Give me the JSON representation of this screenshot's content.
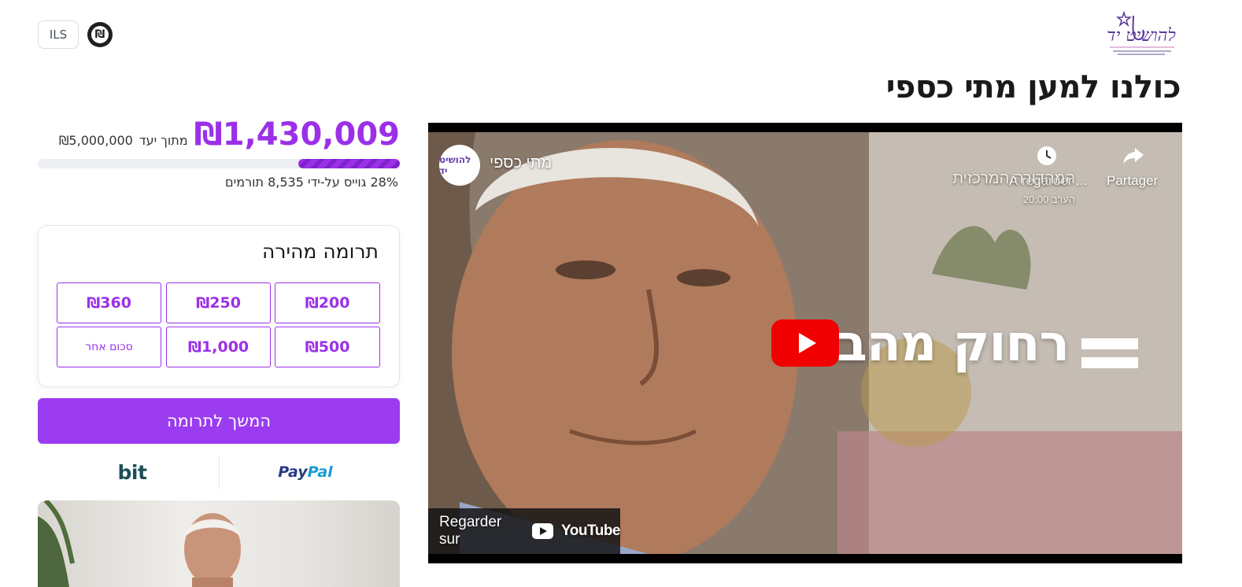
{
  "header": {
    "currency_button": "ILS",
    "currency_symbol": "₪",
    "logo_text": "להושיט יד"
  },
  "campaign": {
    "title": "כולנו למען מתי כספי"
  },
  "progress": {
    "raised": "₪1,430,009",
    "of_goal_label": "מתוך יעד",
    "goal": "₪5,000,000",
    "percent": 28,
    "stats_text": "28% גוייס על-ידי 8,535 תורמים"
  },
  "quick_donation": {
    "title": "תרומה מהירה",
    "amounts": [
      "₪200",
      "₪250",
      "₪360",
      "₪500",
      "₪1,000",
      "סכום אחר"
    ]
  },
  "cta": {
    "continue_label": "המשך לתרומה"
  },
  "payment_methods": {
    "bit": "bit",
    "paypal_pay": "Pay",
    "paypal_pal": "Pal"
  },
  "video": {
    "channel_name": "מתי כספי",
    "channel_avatar_text": "להושיט יד",
    "watch_later_label": "À regarder ...",
    "share_label": "Partager",
    "watch_on_label": "Regarder sur",
    "youtube_label": "YouTube",
    "broadcast_title": "המהדורה המרכזית",
    "broadcast_time": "הערב 20:00",
    "caption": "רחוק מהבית"
  },
  "colors": {
    "accent": "#9b30e8",
    "youtube_red": "#f00000"
  }
}
